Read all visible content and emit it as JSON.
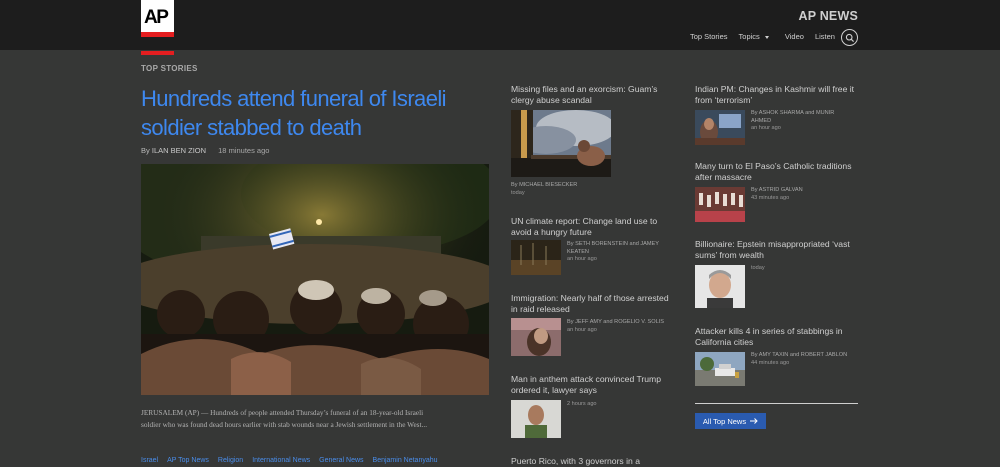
{
  "brand": "AP NEWS",
  "logo": "AP",
  "nav": [
    "Top Stories",
    "Topics",
    "Video",
    "Listen"
  ],
  "section": "TOP STORIES",
  "lead": {
    "title": "Hundreds attend funeral of Israeli soldier stabbed to death",
    "by": "By",
    "author": "ILAN BEN ZION",
    "time": "18 minutes ago",
    "summary": "JERUSALEM (AP) — Hundreds of people attended Thursday’s funeral of an 18-year-old Israeli soldier who was found dead hours earlier with stab wounds near a Jewish settlement in the West...",
    "tags": [
      "Israel",
      "AP Top News",
      "Religion",
      "International News",
      "General News",
      "Benjamin Netanyahu"
    ]
  },
  "col2": [
    {
      "title": "Missing files and an exorcism: Guam’s clergy abuse scandal",
      "author": "By MICHAEL BIESECKER",
      "time": "today"
    },
    {
      "title": "UN climate report: Change land use to avoid a hungry future",
      "author": "By SETH BORENSTEIN and JAMEY KEATEN",
      "time": "an hour ago"
    },
    {
      "title": "Immigration: Nearly half of those arrested in raid released",
      "author": "By JEFF AMY and ROGELIO V. SOLIS",
      "time": "an hour ago"
    },
    {
      "title": "Man in anthem attack convinced Trump ordered it, lawyer says",
      "author": "",
      "time": "2 hours ago"
    },
    {
      "title": "Puerto Rico, with 3 governors in a",
      "author": "",
      "time": ""
    }
  ],
  "col3": [
    {
      "title": "Indian PM: Changes in Kashmir will free it from ‘terrorism’",
      "author": "By ASHOK SHARMA and MUNIR AHMED",
      "time": "an hour ago"
    },
    {
      "title": "Many turn to El Paso’s Catholic traditions after massacre",
      "author": "By ASTRID GALVAN",
      "time": "43 minutes ago"
    },
    {
      "title": "Billionaire: Epstein misappropriated ‘vast sums’ from wealth",
      "author": "",
      "time": "today"
    },
    {
      "title": "Attacker kills 4 in series of stabbings in California cities",
      "author": "By AMY TAXIN and ROBERT JABLON",
      "time": "44 minutes ago"
    }
  ],
  "all_button": "All Top News"
}
